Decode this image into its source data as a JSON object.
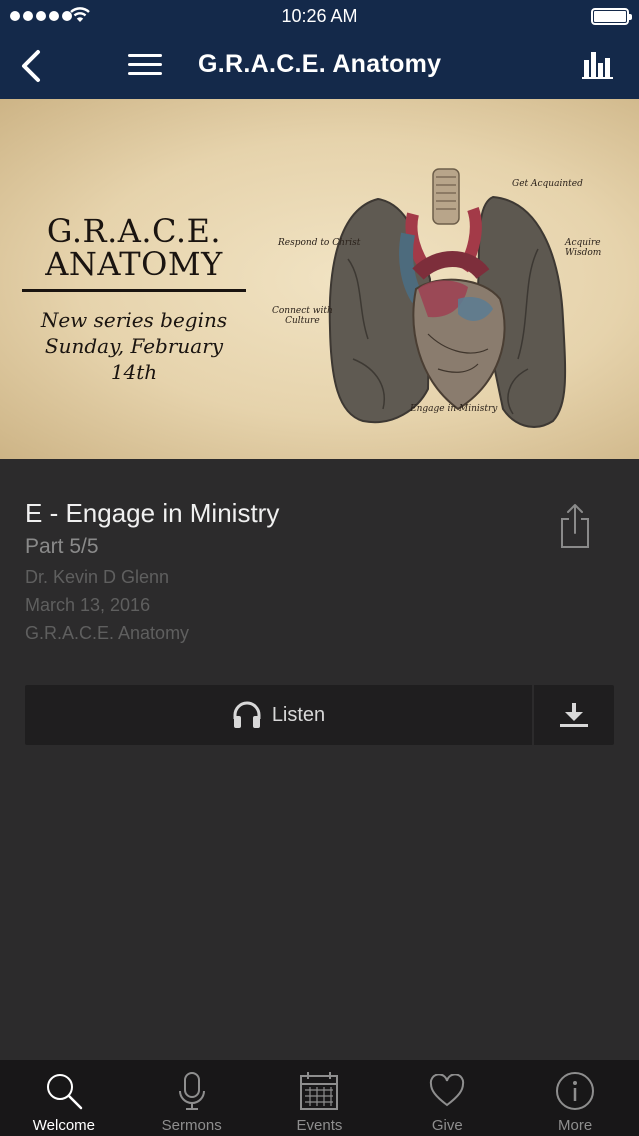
{
  "status_bar": {
    "time": "10:26 AM"
  },
  "nav": {
    "title": "G.R.A.C.E. Anatomy"
  },
  "hero": {
    "title_line1": "G.R.A.C.E.",
    "title_line2": "ANATOMY",
    "subtitle_line1": "New series begins",
    "subtitle_line2": "Sunday, February 14th",
    "annotations": {
      "get_acquainted": "Get Acquainted",
      "respond_to_christ": "Respond to Christ",
      "acquire_wisdom": "Acquire Wisdom",
      "connect_with_culture_1": "Connect with",
      "connect_with_culture_2": "Culture",
      "engage_in_ministry": "Engage in Ministry"
    }
  },
  "sermon": {
    "title": "E - Engage in Ministry",
    "part": "Part 5/5",
    "speaker": "Dr. Kevin D Glenn",
    "date": "March 13, 2016",
    "series": "G.R.A.C.E. Anatomy"
  },
  "actions": {
    "listen_label": "Listen"
  },
  "tabs": [
    {
      "label": "Welcome",
      "icon": "search-icon",
      "active": true
    },
    {
      "label": "Sermons",
      "icon": "microphone-icon",
      "active": false
    },
    {
      "label": "Events",
      "icon": "calendar-icon",
      "active": false
    },
    {
      "label": "Give",
      "icon": "heart-icon",
      "active": false
    },
    {
      "label": "More",
      "icon": "info-icon",
      "active": false
    }
  ],
  "colors": {
    "nav_bg": "#14294a",
    "page_bg": "#2c2b2c",
    "tabbar_bg": "#181718"
  }
}
